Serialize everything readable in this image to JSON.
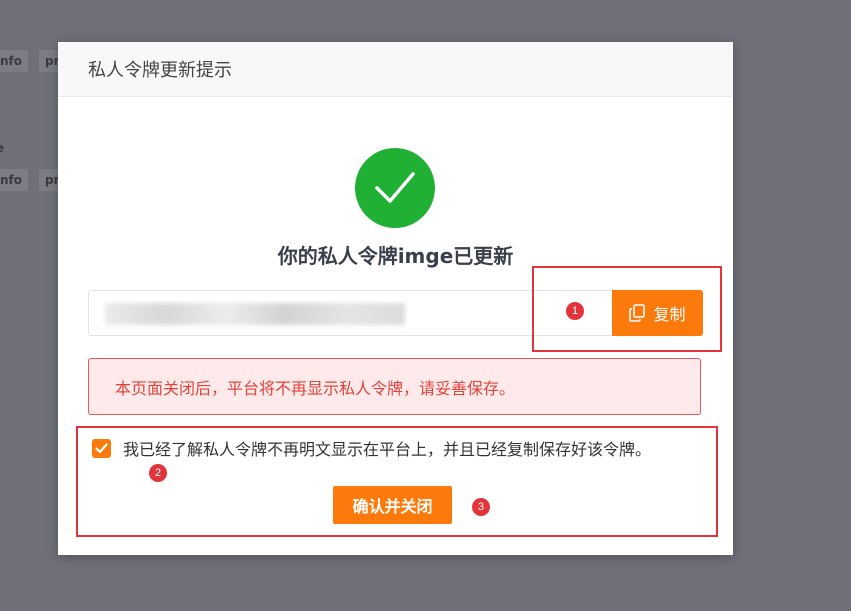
{
  "background": {
    "tags": [
      "nfo",
      "pr",
      "nfo",
      "pr"
    ],
    "fragment": "e"
  },
  "dialog": {
    "title": "私人令牌更新提示",
    "success_icon": "check-icon",
    "headline": "你的私人令牌imge已更新",
    "token": {
      "value_hidden": true
    },
    "copy_button": {
      "label": "复制",
      "icon": "copy-icon"
    },
    "warning": "本页面关闭后，平台将不再显示私人令牌，请妥善保存。",
    "confirm_checkbox": {
      "checked": true,
      "label": "我已经了解私人令牌不再明文显示在平台上，并且已经复制保存好该令牌。"
    },
    "close_button": {
      "label": "确认并关闭"
    }
  },
  "annotations": [
    {
      "number": "1"
    },
    {
      "number": "2"
    },
    {
      "number": "3"
    }
  ],
  "colors": {
    "accent": "#fb7a0b",
    "success": "#1fb034",
    "annotation": "#e3343b",
    "alert_text": "#e0443c",
    "alert_bg": "#feeaea",
    "overlay": "#6e6f78"
  }
}
